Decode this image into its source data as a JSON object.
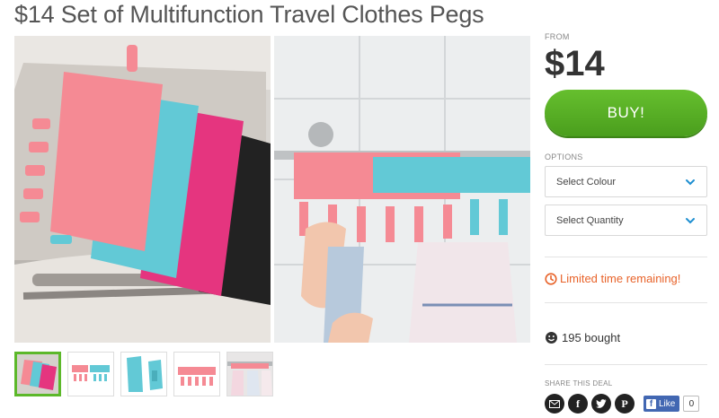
{
  "deal": {
    "title": "$14 Set of Multifunction Travel Clothes Pegs"
  },
  "pricing": {
    "from_label": "FROM",
    "price": "$14",
    "buy_label": "BUY!"
  },
  "options": {
    "label": "OPTIONS",
    "colour_placeholder": "Select Colour",
    "quantity_placeholder": "Select Quantity"
  },
  "status": {
    "limited": "Limited time remaining!",
    "bought": "195 bought"
  },
  "share": {
    "label": "SHARE THIS DEAL",
    "fb_like": "Like",
    "fb_count": "0",
    "icons": [
      "email-icon",
      "facebook-icon",
      "twitter-icon",
      "pinterest-icon"
    ]
  },
  "gallery": {
    "thumbnail_count": 5,
    "active_thumbnail": 1
  },
  "colors": {
    "buy_green": "#5cb82a",
    "accent_orange": "#e8632a",
    "select_chevron": "#1f8fd1",
    "peg_pink": "#f58a94",
    "peg_blue": "#62c9d6",
    "pouch_magenta": "#e5357f"
  }
}
